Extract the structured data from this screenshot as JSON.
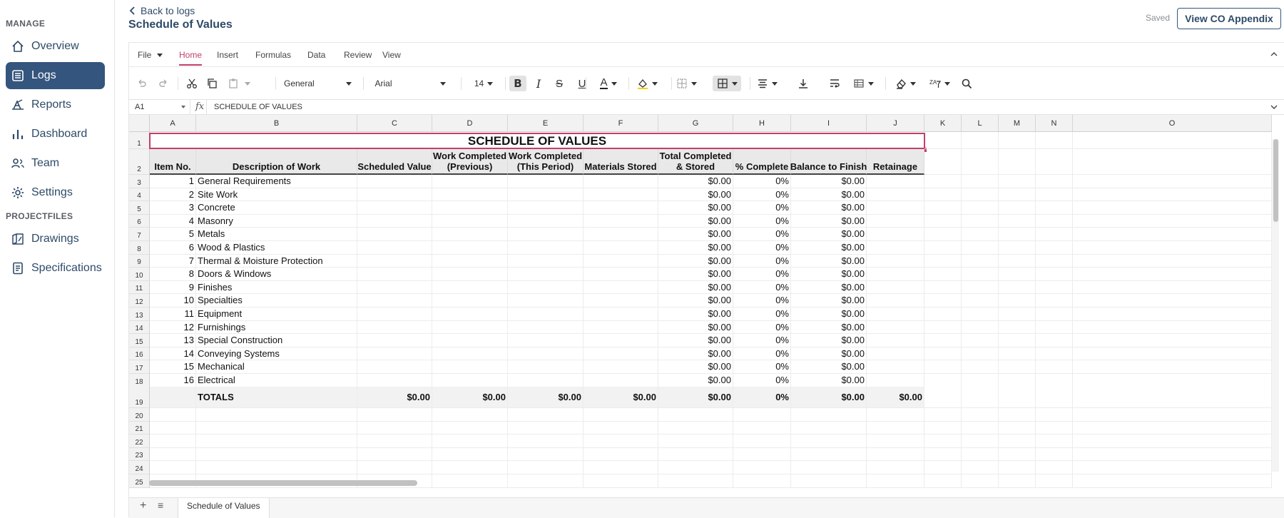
{
  "sidebar": {
    "sections": [
      {
        "label": "MANAGE",
        "items": [
          {
            "label": "Overview",
            "icon": "home-icon"
          },
          {
            "label": "Logs",
            "icon": "logs-icon",
            "active": true
          },
          {
            "label": "Reports",
            "icon": "reports-icon"
          },
          {
            "label": "Dashboard",
            "icon": "dashboard-icon"
          },
          {
            "label": "Team",
            "icon": "team-icon"
          },
          {
            "label": "Settings",
            "icon": "gear-icon"
          }
        ]
      },
      {
        "label": "PROJECTFILES",
        "items": [
          {
            "label": "Drawings",
            "icon": "drawings-icon"
          },
          {
            "label": "Specifications",
            "icon": "specifications-icon"
          }
        ]
      }
    ]
  },
  "header": {
    "back_label": "Back to logs",
    "title": "Schedule of Values",
    "saved_label": "Saved",
    "co_button": "View CO Appendix"
  },
  "menu": {
    "file": "File",
    "tabs": [
      "Home",
      "Insert",
      "Formulas",
      "Data",
      "Review",
      "View"
    ],
    "active_tab": "Home"
  },
  "toolbar": {
    "number_format": "General",
    "font": "Arial",
    "font_size": "14"
  },
  "formula_bar": {
    "cell_ref": "A1",
    "fx": "fx",
    "value": "SCHEDULE OF VALUES"
  },
  "sheet": {
    "columns": [
      "A",
      "B",
      "C",
      "D",
      "E",
      "F",
      "G",
      "H",
      "I",
      "J",
      "K",
      "L",
      "M",
      "N",
      "O"
    ],
    "title": "SCHEDULE OF VALUES",
    "headers": [
      "Item No.",
      "Description of Work",
      "Scheduled Value",
      "Work Completed\n(Previous)",
      "Work Completed\n(This Period)",
      "Materials Stored",
      "Total Completed\n& Stored",
      "% Complete",
      "Balance to Finish",
      "Retainage"
    ],
    "rows": [
      {
        "item": "1",
        "desc": "General Requirements",
        "total": "$0.00",
        "pct": "0%",
        "balance": "$0.00"
      },
      {
        "item": "2",
        "desc": "Site Work",
        "total": "$0.00",
        "pct": "0%",
        "balance": "$0.00"
      },
      {
        "item": "3",
        "desc": "Concrete",
        "total": "$0.00",
        "pct": "0%",
        "balance": "$0.00"
      },
      {
        "item": "4",
        "desc": "Masonry",
        "total": "$0.00",
        "pct": "0%",
        "balance": "$0.00"
      },
      {
        "item": "5",
        "desc": "Metals",
        "total": "$0.00",
        "pct": "0%",
        "balance": "$0.00"
      },
      {
        "item": "6",
        "desc": "Wood & Plastics",
        "total": "$0.00",
        "pct": "0%",
        "balance": "$0.00"
      },
      {
        "item": "7",
        "desc": "Thermal & Moisture Protection",
        "total": "$0.00",
        "pct": "0%",
        "balance": "$0.00"
      },
      {
        "item": "8",
        "desc": "Doors & Windows",
        "total": "$0.00",
        "pct": "0%",
        "balance": "$0.00"
      },
      {
        "item": "9",
        "desc": "Finishes",
        "total": "$0.00",
        "pct": "0%",
        "balance": "$0.00"
      },
      {
        "item": "10",
        "desc": "Specialties",
        "total": "$0.00",
        "pct": "0%",
        "balance": "$0.00"
      },
      {
        "item": "11",
        "desc": "Equipment",
        "total": "$0.00",
        "pct": "0%",
        "balance": "$0.00"
      },
      {
        "item": "12",
        "desc": "Furnishings",
        "total": "$0.00",
        "pct": "0%",
        "balance": "$0.00"
      },
      {
        "item": "13",
        "desc": "Special Construction",
        "total": "$0.00",
        "pct": "0%",
        "balance": "$0.00"
      },
      {
        "item": "14",
        "desc": "Conveying Systems",
        "total": "$0.00",
        "pct": "0%",
        "balance": "$0.00"
      },
      {
        "item": "15",
        "desc": "Mechanical",
        "total": "$0.00",
        "pct": "0%",
        "balance": "$0.00"
      },
      {
        "item": "16",
        "desc": "Electrical",
        "total": "$0.00",
        "pct": "0%",
        "balance": "$0.00"
      }
    ],
    "totals": {
      "label": "TOTALS",
      "scheduled": "$0.00",
      "previous": "$0.00",
      "this_period": "$0.00",
      "materials": "$0.00",
      "total": "$0.00",
      "pct": "0%",
      "balance": "$0.00",
      "retainage": "$0.00"
    },
    "row_numbers": [
      "1",
      "2",
      "3",
      "4",
      "5",
      "6",
      "7",
      "8",
      "9",
      "10",
      "11",
      "12",
      "13",
      "14",
      "15",
      "16",
      "17",
      "18",
      "19",
      "20",
      "21",
      "22",
      "23",
      "24",
      "25"
    ],
    "tab_name": "Schedule of Values"
  },
  "colors": {
    "accent": "#c23f6d",
    "sidebar_active": "#34557d",
    "nav_text": "#2e4a68"
  }
}
